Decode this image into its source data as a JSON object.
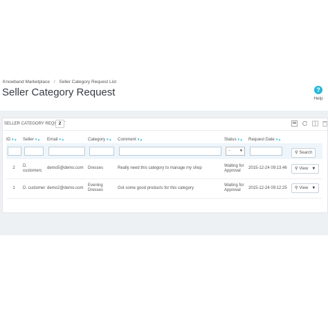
{
  "header": {
    "breadcrumb": [
      "Knowband Marketplace",
      "Seller Category Request List"
    ],
    "breadcrumb_sep": "/",
    "title": "Seller Category Request",
    "help_label": "Help",
    "help_icon_glyph": "?"
  },
  "panel": {
    "title": "SELLER CATEGORY REQUEST",
    "count": "2",
    "toolbar_icons": [
      "export-icon",
      "refresh-icon",
      "columns-icon",
      "delete-icon"
    ]
  },
  "table": {
    "columns": [
      "ID",
      "Seller",
      "Email",
      "Category",
      "Comment",
      "Status",
      "Request Date"
    ],
    "sort_glyphs": "▼▲",
    "status_filter_value": "-",
    "search_label": "Search",
    "rows": [
      {
        "id": "2",
        "seller": "D. customerc",
        "email": "demo5@demo.com",
        "category": "Dresses",
        "comment": "Really need this category to manage my shop",
        "status": "Waiting for Approval",
        "date": "2015-12-24 09:13:46",
        "action": "View"
      },
      {
        "id": "1",
        "seller": "D. customer",
        "email": "demo2@demo.com",
        "category": "Evening Dresses",
        "comment": "Got some good products for this category",
        "status": "Waiting for Approval",
        "date": "2015-12-24 09:12:25",
        "action": "View"
      }
    ]
  },
  "colors": {
    "accent": "#25b9d7",
    "filter_bg": "#eef5fb",
    "content_bg": "#eef1f3"
  }
}
